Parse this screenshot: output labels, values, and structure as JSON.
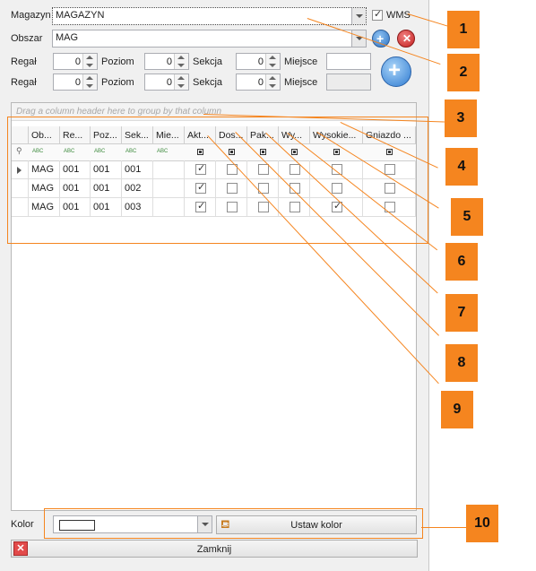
{
  "form": {
    "magazyn_label": "Magazyn",
    "magazyn_value": "MAGAZYN",
    "wms_label": "WMS",
    "wms_checked": true,
    "obszar_label": "Obszar",
    "obszar_value": "MAG",
    "range_from": {
      "regal_label": "Regał",
      "regal": "0",
      "poziom_label": "Poziom",
      "poziom": "0",
      "sekcja_label": "Sekcja",
      "sekcja": "0",
      "miejsce_label": "Miejsce",
      "miejsce": ""
    },
    "range_to": {
      "regal_label": "Regał",
      "regal": "0",
      "poziom_label": "Poziom",
      "poziom": "0",
      "sekcja_label": "Sekcja",
      "sekcja": "0",
      "miejsce_label": "Miejsce",
      "miejsce": ""
    }
  },
  "grid": {
    "group_hint": "Drag a column header here to group by that column",
    "columns": [
      "Ob...",
      "Re...",
      "Poz...",
      "Sek...",
      "Mie...",
      "Akt...",
      "Dos...",
      "Pak...",
      "Wy...",
      "Wysokie...",
      "Gniazdo ..."
    ],
    "filter_text_icon": "abc-filter-icon",
    "filter_bool_icon": "checkbox-filter-icon",
    "rows": [
      {
        "obszar": "MAG",
        "regal": "001",
        "poziom": "001",
        "sekcja": "001",
        "miejsce": "",
        "aktywne": true,
        "dos": false,
        "pak": false,
        "wy": false,
        "wysokie": false,
        "gniazdo": false
      },
      {
        "obszar": "MAG",
        "regal": "001",
        "poziom": "001",
        "sekcja": "002",
        "miejsce": "",
        "aktywne": true,
        "dos": false,
        "pak": false,
        "wy": false,
        "wysokie": false,
        "gniazdo": false
      },
      {
        "obszar": "MAG",
        "regal": "001",
        "poziom": "001",
        "sekcja": "003",
        "miejsce": "",
        "aktywne": true,
        "dos": false,
        "pak": false,
        "wy": false,
        "wysokie": true,
        "gniazdo": false
      }
    ]
  },
  "footer": {
    "kolor_label": "Kolor",
    "ustaw_kolor_label": "Ustaw kolor",
    "zamknij_label": "Zamknij"
  },
  "annotations": [
    "1",
    "2",
    "3",
    "4",
    "5",
    "6",
    "7",
    "8",
    "9",
    "10"
  ],
  "colors": {
    "annotation": "#f5851f",
    "grid_border": "#b8b8b8",
    "panel_bg": "#f0f0f0"
  }
}
